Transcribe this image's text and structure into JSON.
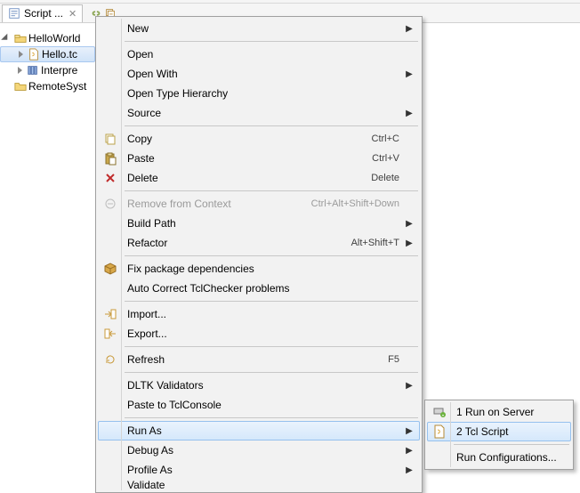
{
  "tab": {
    "title": "Script ...",
    "close_glyph": "✕"
  },
  "tree": {
    "items": [
      {
        "label": "HelloWorld"
      },
      {
        "label": "Hello.tc"
      },
      {
        "label": "Interpre"
      },
      {
        "label": "RemoteSyst"
      }
    ]
  },
  "menu": {
    "items": [
      {
        "label": "New",
        "submenu": true
      },
      {
        "sep": true
      },
      {
        "label": "Open"
      },
      {
        "label": "Open With",
        "submenu": true
      },
      {
        "label": "Open Type Hierarchy"
      },
      {
        "label": "Source",
        "submenu": true
      },
      {
        "sep": true
      },
      {
        "label": "Copy",
        "accel": "Ctrl+C",
        "icon": "copy"
      },
      {
        "label": "Paste",
        "accel": "Ctrl+V",
        "icon": "paste"
      },
      {
        "label": "Delete",
        "accel": "Delete",
        "icon": "delete"
      },
      {
        "sep": true
      },
      {
        "label": "Remove from Context",
        "accel": "Ctrl+Alt+Shift+Down",
        "disabled": true,
        "icon": "remove-context"
      },
      {
        "label": "Build Path",
        "submenu": true
      },
      {
        "label": "Refactor",
        "accel": "Alt+Shift+T",
        "submenu": true
      },
      {
        "sep": true
      },
      {
        "label": "Fix package dependencies",
        "icon": "package"
      },
      {
        "label": "Auto Correct TclChecker problems"
      },
      {
        "sep": true
      },
      {
        "label": "Import...",
        "icon": "import"
      },
      {
        "label": "Export...",
        "icon": "export"
      },
      {
        "sep": true
      },
      {
        "label": "Refresh",
        "accel": "F5",
        "icon": "refresh"
      },
      {
        "sep": true
      },
      {
        "label": "DLTK Validators",
        "submenu": true
      },
      {
        "label": "Paste to TclConsole"
      },
      {
        "sep": true
      },
      {
        "label": "Run As",
        "submenu": true,
        "highlight": true
      },
      {
        "label": "Debug As",
        "submenu": true
      },
      {
        "label": "Profile As",
        "submenu": true
      },
      {
        "label": "Validate",
        "cutoff": true
      }
    ]
  },
  "submenu": {
    "items": [
      {
        "label": "1 Run on Server",
        "icon": "server"
      },
      {
        "label": "2 Tcl Script",
        "icon": "tcl",
        "highlight": true
      },
      {
        "sep": true
      },
      {
        "label": "Run Configurations..."
      }
    ]
  }
}
